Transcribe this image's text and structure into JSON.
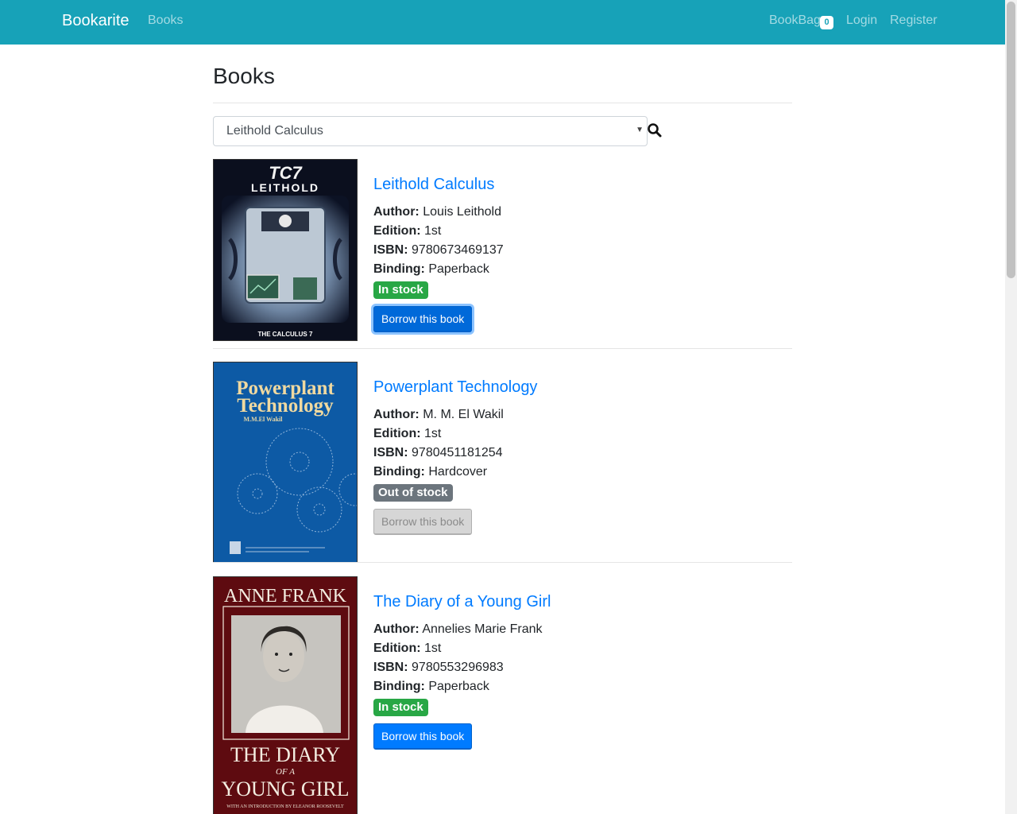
{
  "nav": {
    "brand": "Bookarite",
    "books": "Books",
    "bookbag": "BookBag",
    "bookbag_count": "0",
    "login": "Login",
    "register": "Register"
  },
  "page": {
    "title": "Books",
    "search_value": "Leithold Calculus"
  },
  "labels": {
    "author": "Author:",
    "edition": "Edition:",
    "isbn": "ISBN:",
    "binding": "Binding:"
  },
  "books": [
    {
      "title": "Leithold Calculus",
      "author": "Louis Leithold",
      "edition": "1st",
      "isbn": "9780673469137",
      "binding": "Paperback",
      "stock": "In stock",
      "button": "Borrow this book",
      "cover": {
        "top": "TC7",
        "mid": "LEITHOLD",
        "bottom": "THE CALCULUS 7"
      }
    },
    {
      "title": "Powerplant Technology",
      "author": "M. M. El Wakil",
      "edition": "1st",
      "isbn": "9780451181254",
      "binding": "Hardcover",
      "stock": "Out of stock",
      "button": "Borrow this book",
      "cover": {
        "title1": "Powerplant",
        "title2": "Technology",
        "author": "M.M.El Wakil"
      }
    },
    {
      "title": "The Diary of a Young Girl",
      "author": "Annelies Marie Frank",
      "edition": "1st",
      "isbn": "9780553296983",
      "binding": "Paperback",
      "stock": "In stock",
      "button": "Borrow this book",
      "cover": {
        "top": "ANNE FRANK",
        "line1": "THE DIARY",
        "line2": "OF A",
        "line3": "YOUNG GIRL",
        "intro": "WITH AN INTRODUCTION BY ELEANOR ROOSEVELT"
      }
    }
  ],
  "colors": {
    "navbar": "#17a2b8",
    "link": "#007bff",
    "success": "#28a745",
    "muted": "#6c757d"
  }
}
